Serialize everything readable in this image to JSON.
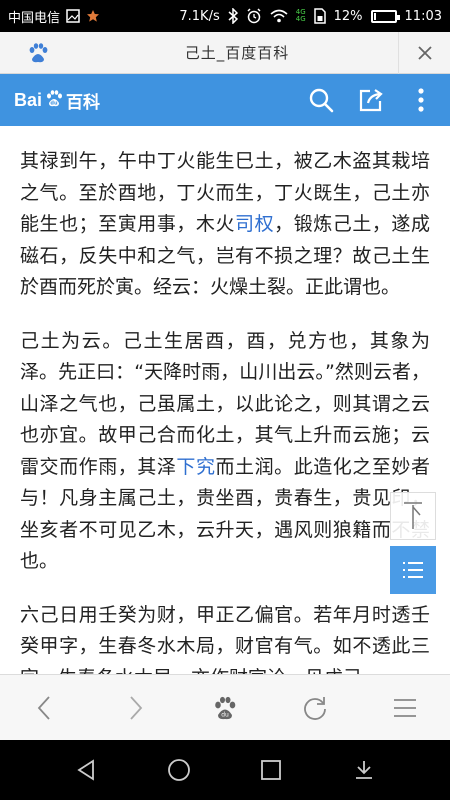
{
  "status_bar": {
    "carrier": "中国电信",
    "speed": "7.1K/s",
    "network_badge_top": "4G",
    "network_badge_bottom": "4G",
    "battery_percent": "12%",
    "battery_level": 0.12,
    "time": "11:03"
  },
  "title_bar": {
    "title": "己土_百度百科",
    "paw_icon": "baidu-paw-icon",
    "close_icon": "close-icon"
  },
  "header": {
    "logo_text_left": "Bai",
    "logo_text_right": "百科",
    "icons": [
      "search-icon",
      "share-icon",
      "more-vertical-icon"
    ],
    "accent_color": "#3f93e0"
  },
  "content": {
    "paragraphs": [
      {
        "before": "其禄到午，午中丁火能生巳土，被乙木盗其栽培之气。至於酉地，丁火而生，丁火既生，己土亦能生也；至寅用事，木火",
        "link": "司权",
        "after": "，锻炼己土，遂成磁石，反失中和之气，岂有不损之理？故己土生於酉而死於寅。经云：火燥土裂。正此谓也。"
      },
      {
        "before": "己土为云。己土生居酉，酉，兑方也，其象为泽。先正曰：“天降时雨，山川出云。”然则云者，山泽之气也，己虽属土，以此论之，则其谓之云也亦宜。故甲己合而化土，其气上升而云施；云雷交而作雨，其泽",
        "link": "下究",
        "after": "而土润。此造化之至妙者与！凡身主属己土，贵坐酉，贵春生，贵见印，坐亥者不可见乙木，云升天，遇风则狼籍而不禁也。"
      },
      {
        "before": "六己日用壬癸为财，甲正乙偏官。若年月时透壬癸甲字，生春冬水木局，财官有气。如不透此三字，生春冬水木局，亦作财官论。见戊己",
        "link": "",
        "after": ""
      }
    ]
  },
  "float_buttons": {
    "top_label": "回顶部",
    "toc_icon": "list-icon"
  },
  "toolbar": {
    "icons": [
      "back-icon",
      "forward-icon",
      "baidu-paw-icon",
      "refresh-icon",
      "menu-icon"
    ]
  },
  "nav_bar": {
    "icons": [
      "nav-back-icon",
      "nav-home-icon",
      "nav-recents-icon",
      "nav-notification-icon"
    ]
  }
}
